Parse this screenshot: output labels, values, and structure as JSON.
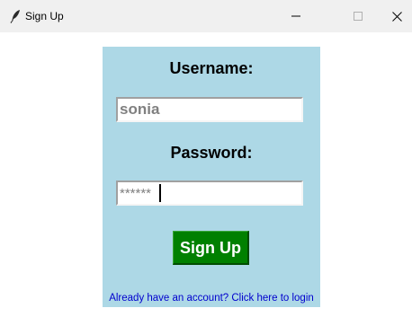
{
  "window": {
    "title": "Sign Up",
    "icon": "feather-icon",
    "controls": [
      "minimize-icon",
      "maximize-icon",
      "close-icon"
    ]
  },
  "form": {
    "background": "#add8e6",
    "username_label": "Username:",
    "username_value": "sonia",
    "password_label": "Password:",
    "password_value": "******",
    "signup_label": "Sign Up",
    "signup_color": "#008000",
    "login_link": "Already have an account? Click here to login",
    "login_link_color": "#0000cd"
  }
}
